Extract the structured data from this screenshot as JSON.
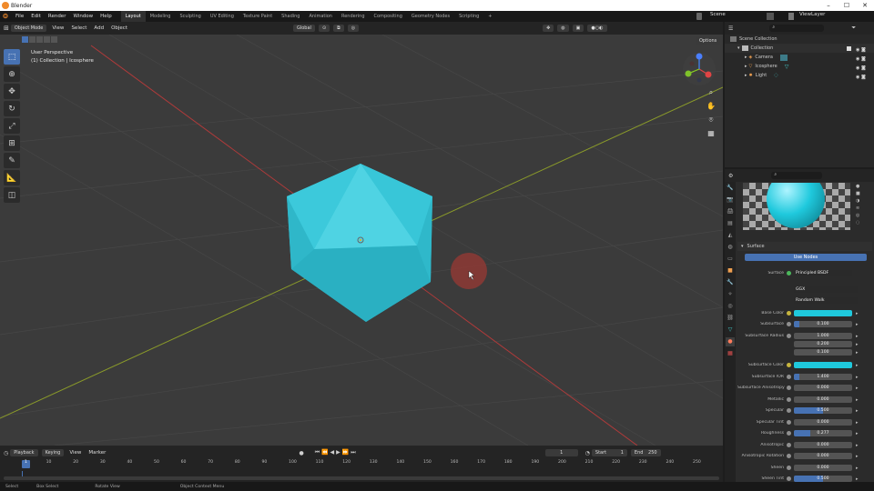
{
  "app": {
    "title": "Blender"
  },
  "menu": [
    "File",
    "Edit",
    "Render",
    "Window",
    "Help"
  ],
  "workspaces": [
    "Layout",
    "Modeling",
    "Sculpting",
    "UV Editing",
    "Texture Paint",
    "Shading",
    "Animation",
    "Rendering",
    "Compositing",
    "Geometry Nodes",
    "Scripting"
  ],
  "workspace_add": "+",
  "scene": {
    "name": "Scene",
    "view_layer": "ViewLayer"
  },
  "viewport_header": {
    "mode": "Object Mode",
    "view": "View",
    "select": "Select",
    "add": "Add",
    "object": "Object",
    "transform": "Global",
    "options": "Options"
  },
  "viewport": {
    "line1": "User Perspective",
    "line2": "(1) Collection | Icosphere"
  },
  "outliner": {
    "search_placeholder": "",
    "items": [
      {
        "label": "Scene Collection",
        "indent": 0
      },
      {
        "label": "Collection",
        "indent": 1
      },
      {
        "label": "Camera",
        "indent": 2
      },
      {
        "label": "Icosphere",
        "indent": 2
      },
      {
        "label": "Light",
        "indent": 2
      }
    ]
  },
  "properties": {
    "section": "Surface",
    "use_nodes": "Use Nodes",
    "surface_label": "Surface",
    "surface_value": "Principled BSDF",
    "distribution": "GGX",
    "subsurface_method": "Random Walk",
    "rows": [
      {
        "label": "Base Color",
        "value": "",
        "color": "#1fc9dd",
        "fill": 0
      },
      {
        "label": "Subsurface",
        "value": "0.100",
        "fill": 0.1
      },
      {
        "label": "Subsurface Radius",
        "value": "1.000",
        "fill": 0
      },
      {
        "label": "",
        "value": "0.200",
        "fill": 0
      },
      {
        "label": "",
        "value": "0.100",
        "fill": 0
      },
      {
        "label": "Subsurface Color",
        "value": "",
        "color": "#1fc9dd",
        "fill": 0
      },
      {
        "label": "Subsurface IOR",
        "value": "1.400",
        "fill": 0.1
      },
      {
        "label": "Subsurface Anisotropy",
        "value": "0.000",
        "fill": 0
      },
      {
        "label": "Metallic",
        "value": "0.000",
        "fill": 0
      },
      {
        "label": "Specular",
        "value": "0.500",
        "fill": 0.5
      },
      {
        "label": "Specular Tint",
        "value": "0.000",
        "fill": 0
      },
      {
        "label": "Roughness",
        "value": "0.277",
        "fill": 0.277
      },
      {
        "label": "Anisotropic",
        "value": "0.000",
        "fill": 0
      },
      {
        "label": "Anisotropic Rotation",
        "value": "0.000",
        "fill": 0
      },
      {
        "label": "Sheen",
        "value": "0.000",
        "fill": 0
      },
      {
        "label": "Sheen Tint",
        "value": "0.500",
        "fill": 0.5
      }
    ]
  },
  "timeline": {
    "playback": "Playback",
    "keying": "Keying",
    "view": "View",
    "marker": "Marker",
    "current_frame": "1",
    "start_label": "Start",
    "start": "1",
    "end_label": "End",
    "end": "250",
    "ticks": [
      "1",
      "10",
      "20",
      "30",
      "40",
      "50",
      "60",
      "70",
      "80",
      "90",
      "100",
      "110",
      "120",
      "130",
      "140",
      "150",
      "160",
      "170",
      "180",
      "190",
      "200",
      "210",
      "220",
      "230",
      "240",
      "250"
    ]
  },
  "status": {
    "select": "Select",
    "box_select": "Box Select",
    "rotate_view": "Rotate View",
    "context_menu": "Object Context Menu"
  },
  "colors": {
    "accent": "#4772b3",
    "object": "#33c4d6",
    "cursor_ring": "#c0392b"
  }
}
